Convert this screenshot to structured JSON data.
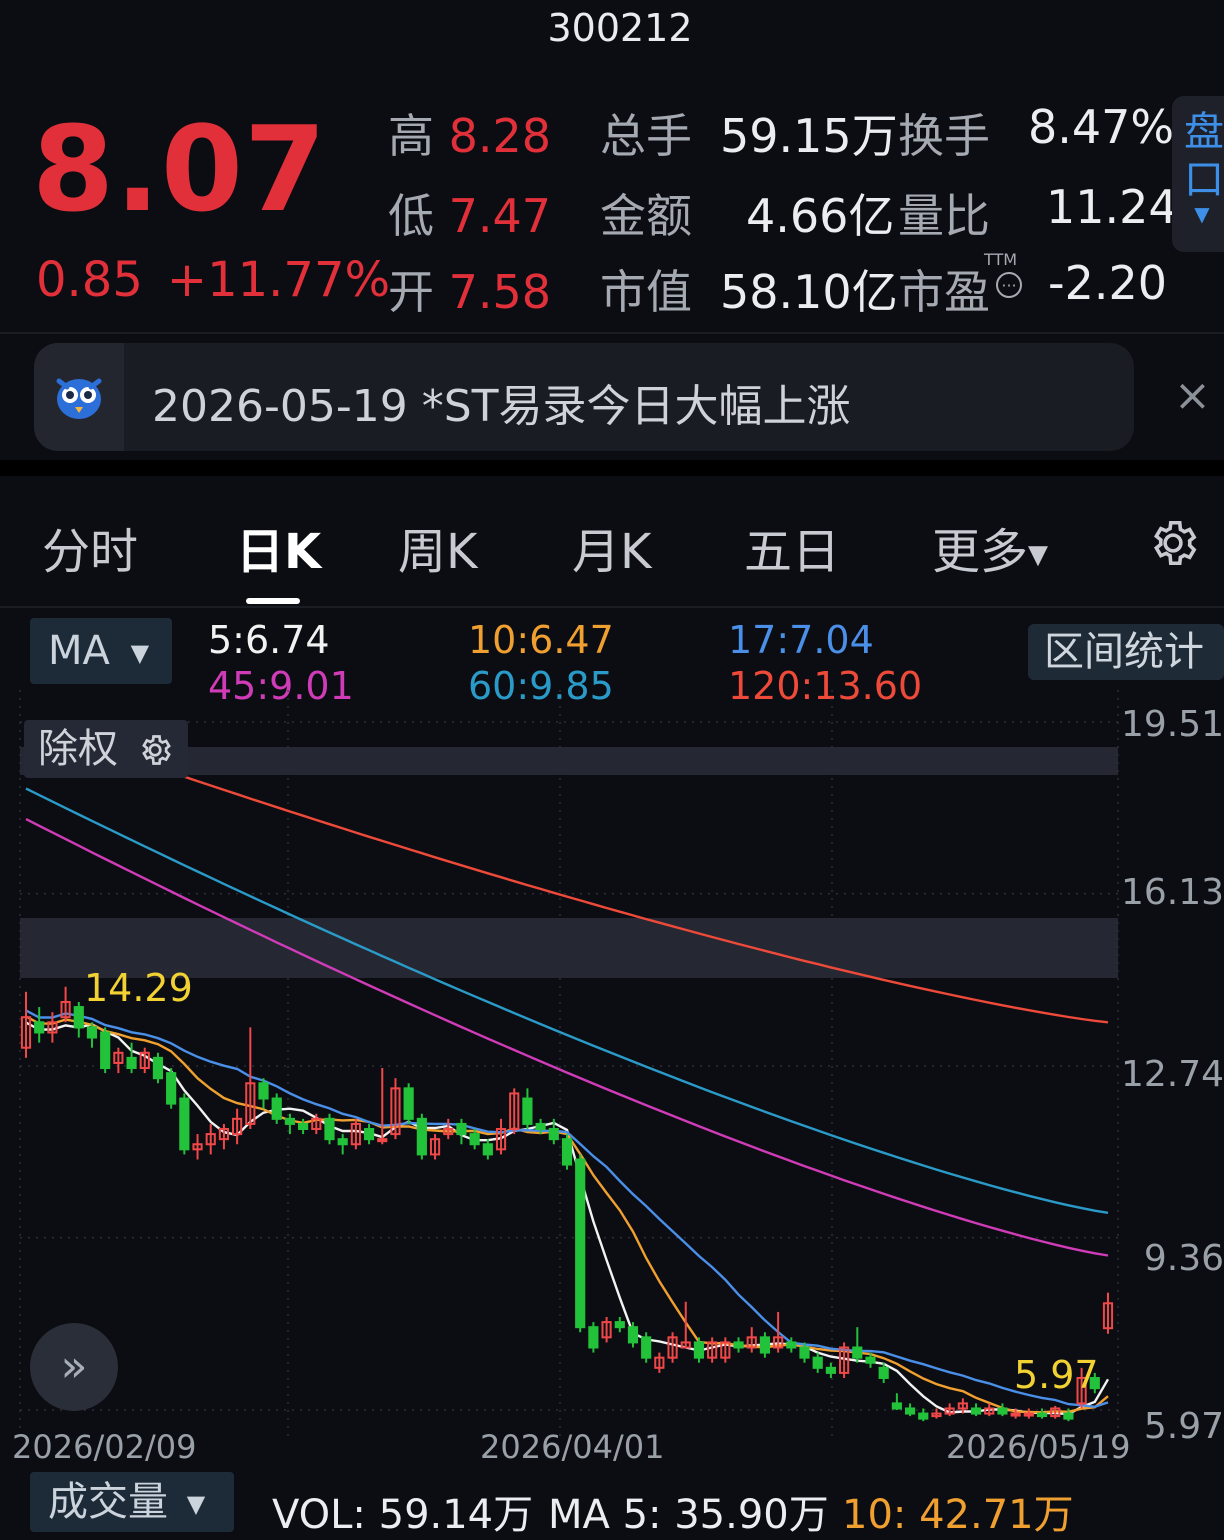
{
  "header": {
    "code": "300212",
    "price": "8.07",
    "change": "0.85",
    "change_pct": "+11.77%",
    "stats": {
      "high_label": "高",
      "high": "8.28",
      "low_label": "低",
      "low": "7.47",
      "open_label": "开",
      "open": "7.58",
      "vol_label": "总手",
      "vol": "59.15万",
      "amount_label": "金额",
      "amount": "4.66亿",
      "mktcap_label": "市值",
      "mktcap": "58.10亿",
      "turnover_label": "换手",
      "turnover": "8.47%",
      "ratio_label": "量比",
      "ratio": "11.24",
      "pe_label": "市盈",
      "pe_sup": "TTM",
      "pe": "-2.20"
    },
    "pankou_label": "盘口"
  },
  "news": {
    "text": "2026-05-19 *ST易录今日大幅上涨",
    "close": "×"
  },
  "tabs": [
    "分时",
    "日K",
    "周K",
    "月K",
    "五日",
    "更多"
  ],
  "ma_bar": {
    "select": "MA",
    "values": [
      {
        "text": "5:6.74",
        "color": "#f2f2f2"
      },
      {
        "text": "10:6.47",
        "color": "#f0a030"
      },
      {
        "text": "17:7.04",
        "color": "#4a8fe8"
      },
      {
        "text": "45:9.01",
        "color": "#d03cb8"
      },
      {
        "text": "60:9.85",
        "color": "#2a9bc8"
      },
      {
        "text": "120:13.60",
        "color": "#ee4a3a"
      }
    ],
    "range_button": "区间统计"
  },
  "chart": {
    "chuquan_label": "除权",
    "expand_icon": "»",
    "chart_data": {
      "type": "candlestick",
      "y_ticks": [
        "19.51",
        "16.13",
        "12.74",
        "9.36",
        "5.97"
      ],
      "ylim": [
        5.97,
        19.51
      ],
      "x_ticks": [
        "2026/02/09",
        "2026/04/01",
        "2026/05/19"
      ],
      "annotations": [
        {
          "text": "14.29",
          "type": "high"
        },
        {
          "text": "5.97",
          "type": "low"
        }
      ],
      "candles": [
        [
          13.1,
          13.7,
          14.2,
          12.9
        ],
        [
          13.6,
          13.4,
          13.9,
          13.2
        ],
        [
          13.4,
          13.6,
          13.8,
          13.2
        ],
        [
          13.7,
          14.0,
          14.3,
          13.6
        ],
        [
          13.9,
          13.5,
          14.0,
          13.3
        ],
        [
          13.5,
          13.3,
          13.6,
          13.1
        ],
        [
          13.4,
          12.7,
          13.5,
          12.6
        ],
        [
          12.8,
          13.0,
          13.1,
          12.6
        ],
        [
          12.9,
          12.7,
          13.2,
          12.6
        ],
        [
          12.7,
          13.0,
          13.1,
          12.6
        ],
        [
          12.9,
          12.5,
          13.0,
          12.4
        ],
        [
          12.6,
          12.0,
          12.7,
          11.9
        ],
        [
          12.1,
          11.1,
          12.2,
          11.0
        ],
        [
          11.1,
          11.2,
          11.4,
          10.9
        ],
        [
          11.2,
          11.4,
          11.6,
          11.0
        ],
        [
          11.3,
          11.5,
          11.6,
          11.1
        ],
        [
          11.4,
          11.7,
          11.9,
          11.2
        ],
        [
          11.6,
          12.4,
          13.5,
          11.5
        ],
        [
          12.4,
          12.1,
          12.5,
          11.9
        ],
        [
          12.1,
          11.7,
          12.2,
          11.6
        ],
        [
          11.7,
          11.6,
          11.8,
          11.4
        ],
        [
          11.6,
          11.5,
          11.7,
          11.4
        ],
        [
          11.5,
          11.7,
          11.8,
          11.4
        ],
        [
          11.7,
          11.3,
          11.8,
          11.2
        ],
        [
          11.3,
          11.2,
          11.4,
          11.0
        ],
        [
          11.2,
          11.6,
          11.7,
          11.1
        ],
        [
          11.5,
          11.3,
          11.6,
          11.2
        ],
        [
          11.3,
          11.3,
          12.7,
          11.2
        ],
        [
          11.4,
          12.3,
          12.5,
          11.3
        ],
        [
          12.3,
          11.7,
          12.4,
          11.6
        ],
        [
          11.7,
          11.0,
          11.8,
          10.9
        ],
        [
          11.0,
          11.3,
          11.4,
          10.9
        ],
        [
          11.4,
          11.5,
          11.7,
          11.3
        ],
        [
          11.6,
          11.4,
          11.7,
          11.2
        ],
        [
          11.4,
          11.2,
          11.5,
          11.1
        ],
        [
          11.2,
          11.0,
          11.3,
          10.9
        ],
        [
          11.1,
          11.5,
          11.7,
          11.0
        ],
        [
          11.5,
          12.2,
          12.3,
          11.4
        ],
        [
          12.1,
          11.6,
          12.3,
          11.5
        ],
        [
          11.6,
          11.5,
          11.7,
          11.4
        ],
        [
          11.5,
          11.3,
          11.7,
          11.2
        ],
        [
          11.3,
          10.8,
          11.4,
          10.7
        ],
        [
          10.9,
          7.6,
          11.0,
          7.5
        ],
        [
          7.6,
          7.2,
          7.7,
          7.1
        ],
        [
          7.4,
          7.7,
          7.8,
          7.3
        ],
        [
          7.7,
          7.6,
          7.8,
          7.5
        ],
        [
          7.6,
          7.3,
          7.7,
          7.2
        ],
        [
          7.4,
          7.0,
          7.5,
          6.9
        ],
        [
          6.8,
          7.0,
          7.1,
          6.7
        ],
        [
          7.0,
          7.4,
          7.5,
          6.9
        ],
        [
          7.2,
          7.3,
          8.1,
          7.2
        ],
        [
          7.3,
          7.0,
          7.4,
          6.9
        ],
        [
          7.0,
          7.3,
          7.4,
          6.9
        ],
        [
          7.0,
          7.3,
          7.4,
          6.9
        ],
        [
          7.3,
          7.2,
          7.4,
          7.1
        ],
        [
          7.2,
          7.4,
          7.6,
          7.1
        ],
        [
          7.4,
          7.1,
          7.5,
          7.0
        ],
        [
          7.2,
          7.4,
          7.9,
          7.1
        ],
        [
          7.3,
          7.2,
          7.4,
          7.1
        ],
        [
          7.2,
          7.0,
          7.3,
          6.9
        ],
        [
          7.0,
          6.8,
          7.1,
          6.7
        ],
        [
          6.8,
          6.7,
          6.9,
          6.6
        ],
        [
          6.7,
          7.2,
          7.3,
          6.6
        ],
        [
          7.2,
          7.0,
          7.6,
          6.9
        ],
        [
          7.0,
          6.9,
          7.1,
          6.8
        ],
        [
          6.8,
          6.6,
          6.9,
          6.5
        ],
        [
          6.1,
          6.0,
          6.3,
          5.97
        ],
        [
          6.0,
          5.9,
          6.1,
          5.85
        ],
        [
          5.9,
          5.8,
          6.0,
          5.75
        ],
        [
          5.85,
          5.9,
          6.0,
          5.8
        ],
        [
          5.9,
          6.0,
          6.1,
          5.85
        ],
        [
          6.0,
          6.1,
          6.2,
          5.9
        ],
        [
          6.0,
          5.9,
          6.1,
          5.85
        ],
        [
          5.9,
          6.0,
          6.1,
          5.85
        ],
        [
          6.0,
          5.9,
          6.1,
          5.85
        ],
        [
          5.9,
          5.9,
          6.0,
          5.8
        ],
        [
          5.9,
          5.9,
          6.0,
          5.8
        ],
        [
          5.9,
          5.85,
          6.0,
          5.8
        ],
        [
          5.85,
          6.0,
          6.05,
          5.8
        ],
        [
          5.9,
          5.8,
          6.0,
          5.75
        ],
        [
          6.1,
          6.6,
          6.8,
          6.0
        ],
        [
          6.6,
          6.4,
          6.7,
          6.3
        ],
        [
          7.58,
          8.07,
          8.28,
          7.47
        ]
      ],
      "ma_series": [
        {
          "name": "5",
          "color": "#f2f2f2",
          "start": 13.0,
          "end": 6.74
        },
        {
          "name": "10",
          "color": "#f0a030",
          "start": 13.8,
          "end": 6.47
        },
        {
          "name": "17",
          "color": "#4a8fe8",
          "start": 14.6,
          "end": 7.04
        },
        {
          "name": "45",
          "color": "#d03cb8",
          "start": 17.6,
          "end": 9.01
        },
        {
          "name": "60",
          "color": "#2a9bc8",
          "start": 18.2,
          "end": 9.85
        },
        {
          "name": "120",
          "color": "#ee4a3a",
          "start": 19.5,
          "end": 13.6
        }
      ]
    }
  },
  "volume": {
    "select": "成交量",
    "vol": "VOL: 59.14万",
    "ma5": "MA 5: 35.90万",
    "ma10": "10: 42.71万"
  }
}
